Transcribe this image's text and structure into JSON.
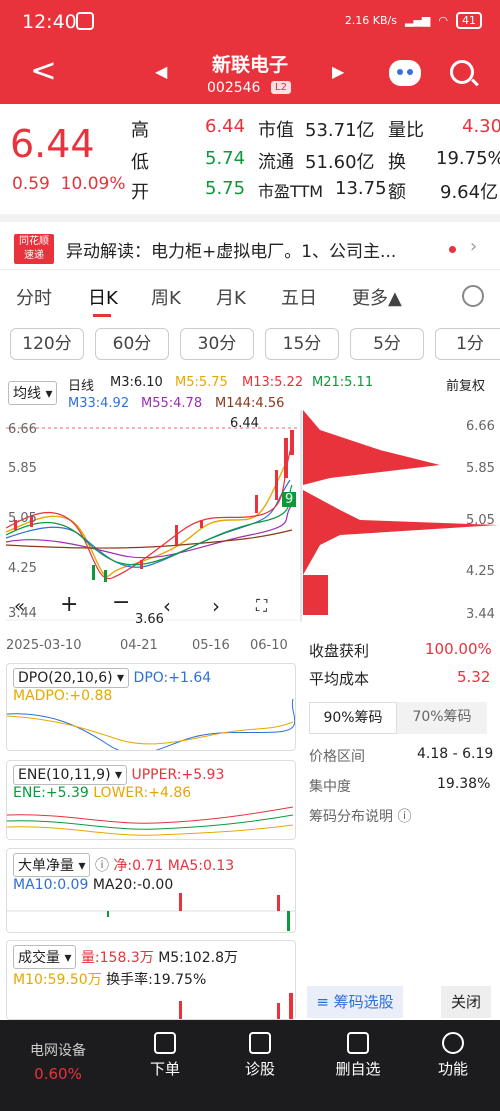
{
  "status": {
    "time": "12:40",
    "net": "2.16 KB/s",
    "battery": "41"
  },
  "header": {
    "back": "<",
    "name": "新联电子",
    "code": "002546",
    "level": "L2"
  },
  "quote": {
    "price": "6.44",
    "change": "0.59",
    "change_pct": "10.09%",
    "high_label": "高",
    "high": "6.44",
    "low_label": "低",
    "low": "5.74",
    "open_label": "开",
    "open": "5.75",
    "mcap_label": "市值",
    "mcap": "53.71亿",
    "float_label": "流通",
    "float": "51.60亿",
    "pe_label": "市盈TTM",
    "pe": "13.75",
    "vr_label": "量比",
    "vr": "4.30",
    "turn_label": "换",
    "turn": "19.75%",
    "amt_label": "额",
    "amt": "9.64亿"
  },
  "news": {
    "logo_top": "同花顺",
    "logo_bottom": "速递",
    "text": "异动解读：电力柜+虚拟电厂。1、公司主..."
  },
  "tabs": [
    "分时",
    "日K",
    "周K",
    "月K",
    "五日",
    "更多▲"
  ],
  "periods": [
    "120分",
    "60分",
    "30分",
    "15分",
    "5分",
    "1分"
  ],
  "kline": {
    "ma_type": "均线",
    "daily": "日线",
    "m3": "M3:6.10",
    "m5": "M5:5.75",
    "m13": "M13:5.22",
    "m21": "M21:5.11",
    "m33": "M33:4.92",
    "m55": "M55:4.78",
    "m144": "M144:4.56",
    "adjust": "前复权",
    "y_ticks": [
      "6.66",
      "5.85",
      "5.05",
      "4.25",
      "3.44"
    ],
    "max_label": "6.44",
    "min_label": "3.66",
    "dates": [
      "2025-03-10",
      "04-21",
      "05-16",
      "06-10"
    ],
    "marker": "9"
  },
  "colors": {
    "red": "#e8323c",
    "green": "#0a9a3a",
    "yellow": "#e6a800",
    "blue": "#2f6fd8",
    "purple": "#9b2fb0",
    "dark": "#1c1c1e"
  },
  "dpo": {
    "name": "DPO(20,10,6)",
    "dpo": "DPO:+1.64",
    "madpo": "MADPO:+0.88"
  },
  "ene": {
    "name": "ENE(10,11,9)",
    "upper": "UPPER:+5.93",
    "ene": "ENE:+5.39",
    "lower": "LOWER:+4.86"
  },
  "flow": {
    "name": "大单净量",
    "net": "净:0.71",
    "ma5": "MA5:0.13",
    "ma10": "MA10:0.09",
    "ma20": "MA20:-0.00"
  },
  "vol": {
    "name": "成交量",
    "vol": "量:158.3万",
    "m5": "M5:102.8万",
    "m10": "M10:59.50万",
    "turn": "换手率:19.75%"
  },
  "chips": {
    "y_ticks": [
      "6.66",
      "5.85",
      "5.05",
      "4.25",
      "3.44"
    ],
    "profit_label": "收盘获利",
    "profit": "100.00%",
    "cost_label": "平均成本",
    "cost": "5.32",
    "tab90": "90%筹码",
    "tab70": "70%筹码",
    "range_label": "价格区间",
    "range": "4.18 - 6.19",
    "conc_label": "集中度",
    "conc": "19.38%",
    "desc": "筹码分布说明",
    "select": "筹码选股",
    "close": "关闭"
  },
  "nav": [
    {
      "label": "电网设备",
      "sub": "0.60%"
    },
    {
      "label": "下单"
    },
    {
      "label": "诊股"
    },
    {
      "label": "删自选"
    },
    {
      "label": "功能"
    }
  ]
}
